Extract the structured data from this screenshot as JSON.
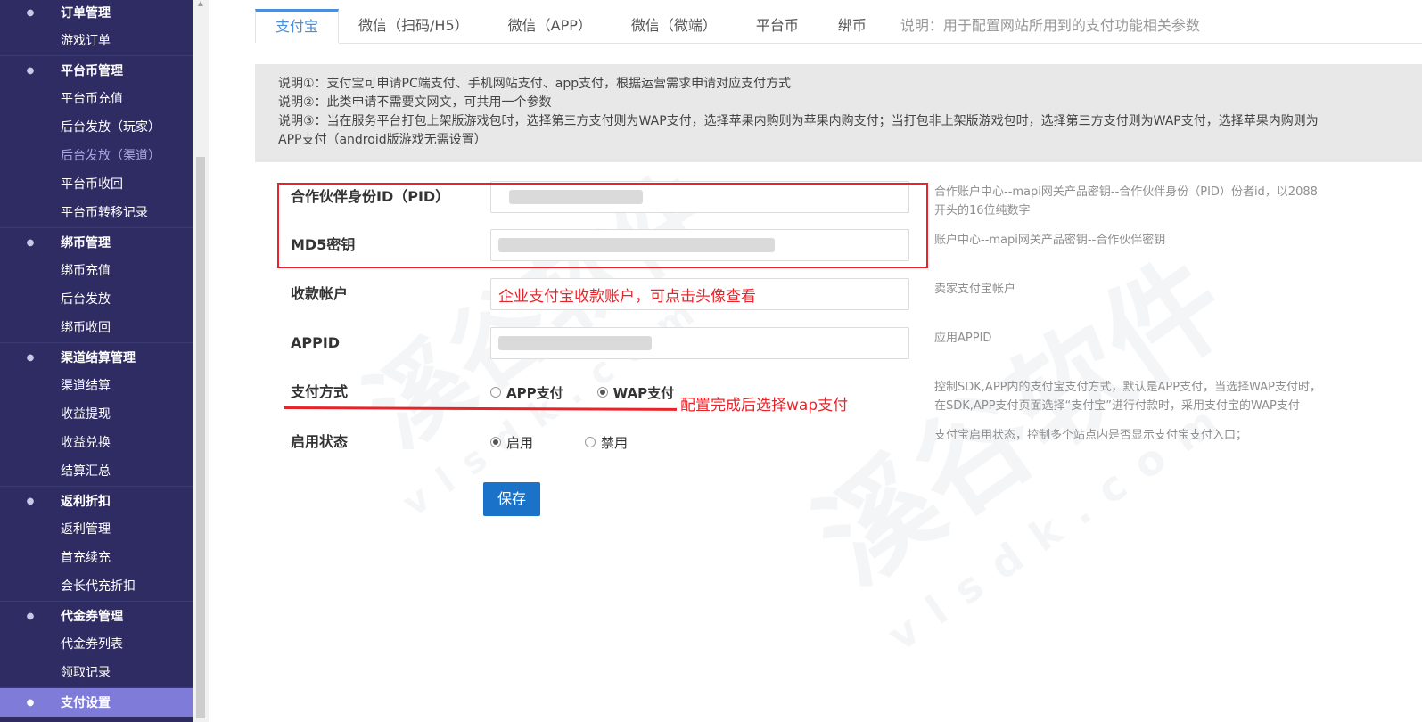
{
  "sidebar": {
    "groups": [
      {
        "label": "订单管理",
        "items": [
          {
            "label": "游戏订单"
          }
        ]
      },
      {
        "label": "平台币管理",
        "items": [
          {
            "label": "平台币充值"
          },
          {
            "label": "后台发放（玩家）"
          },
          {
            "label": "后台发放（渠道）"
          },
          {
            "label": "平台币收回"
          },
          {
            "label": "平台币转移记录"
          }
        ]
      },
      {
        "label": "绑币管理",
        "items": [
          {
            "label": "绑币充值"
          },
          {
            "label": "后台发放"
          },
          {
            "label": "绑币收回"
          }
        ]
      },
      {
        "label": "渠道结算管理",
        "items": [
          {
            "label": "渠道结算"
          },
          {
            "label": "收益提现"
          },
          {
            "label": "收益兑换"
          },
          {
            "label": "结算汇总"
          }
        ]
      },
      {
        "label": "返利折扣",
        "items": [
          {
            "label": "返利管理"
          },
          {
            "label": "首充续充"
          },
          {
            "label": "会长代充折扣"
          }
        ]
      },
      {
        "label": "代金券管理",
        "items": [
          {
            "label": "代金券列表"
          },
          {
            "label": "领取记录"
          }
        ]
      },
      {
        "label": "支付设置",
        "items": []
      }
    ]
  },
  "tabs": [
    {
      "label": "支付宝"
    },
    {
      "label": "微信（扫码/H5）"
    },
    {
      "label": "微信（APP）"
    },
    {
      "label": "微信（微端）"
    },
    {
      "label": "平台币"
    },
    {
      "label": "绑币"
    }
  ],
  "tab_note": "说明：用于配置网站所用到的支付功能相关参数",
  "notice": {
    "line1": "说明①：支付宝可申请PC端支付、手机网站支付、app支付，根据运营需求申请对应支付方式",
    "line2": "说明②：此类申请不需要文网文，可共用一个参数",
    "line3": "说明③：当在服务平台打包上架版游戏包时，选择第三方支付则为WAP支付，选择苹果内购则为苹果内购支付；当打包非上架版游戏包时，选择第三方支付则为WAP支付，选择苹果内购则为",
    "line4": "APP支付（android版游戏无需设置）"
  },
  "form": {
    "pid": {
      "label": "合作伙伴身份ID（PID）",
      "help1": "合作账户中心--mapi网关产品密钥--合作伙伴身份（PID）份者id，以2088",
      "help2": "开头的16位纯数字"
    },
    "md5": {
      "label": "MD5密钥",
      "help": "账户中心--mapi网关产品密钥--合作伙伴密钥"
    },
    "account": {
      "label": "收款帐户",
      "annotation": "企业支付宝收款账户，可点击头像查看",
      "help": "卖家支付宝帐户"
    },
    "appid": {
      "label": "APPID",
      "help": "应用APPID"
    },
    "pay_method": {
      "label": "支付方式",
      "option_app": "APP支付",
      "option_wap": "WAP支付",
      "annotation": "配置完成后选择wap支付",
      "help1": "控制SDK,APP内的支付宝支付方式，默认是APP支付，当选择WAP支付时，",
      "help2": "在SDK,APP支付页面选择“支付宝”进行付款时，采用支付宝的WAP支付"
    },
    "status": {
      "label": "启用状态",
      "option_on": "启用",
      "option_off": "禁用",
      "help": "支付宝启用状态，控制多个站点内是否显示支付宝支付入口；"
    },
    "save_label": "保存"
  },
  "watermark": {
    "brand": "溪谷软件",
    "domain": "vlsdk.com"
  },
  "colors": {
    "sidebar_bg": "#2f2c63",
    "active_group_bg": "#7e7bd9",
    "accent": "#4a90d9",
    "button": "#1a73c8",
    "annotation": "#e8242a"
  }
}
